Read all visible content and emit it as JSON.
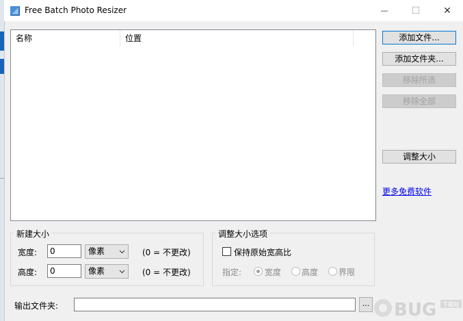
{
  "window": {
    "title": "Free Batch Photo Resizer",
    "minimize_glyph": "—",
    "maximize_glyph": "☐",
    "close_glyph": "✕"
  },
  "file_list": {
    "columns": [
      {
        "label": "名称"
      },
      {
        "label": "位置"
      }
    ]
  },
  "buttons": {
    "add_files": "添加文件...",
    "add_folder": "添加文件夹...",
    "remove_selected": "移除所选",
    "remove_all": "移除全部",
    "resize": "调整大小"
  },
  "more_software_link": "更多免费软件",
  "new_size": {
    "group_title": "新建大小",
    "width_label": "宽度:",
    "width_value": "0",
    "width_unit": "像素",
    "width_hint": "(0 = 不更改)",
    "height_label": "高度:",
    "height_value": "0",
    "height_unit": "像素",
    "height_hint": "(0 = 不更改)"
  },
  "resize_options": {
    "group_title": "调整大小选项",
    "keep_ratio_label": "保持原始宽高比",
    "keep_ratio_checked": false,
    "specify_label": "指定:",
    "radios": [
      {
        "label": "宽度",
        "checked": true
      },
      {
        "label": "高度",
        "checked": false
      },
      {
        "label": "界限",
        "checked": false
      }
    ]
  },
  "output": {
    "label": "输出文件夹:",
    "value": "",
    "browse_label": "..."
  },
  "watermark": {
    "text": "BUG",
    "subtext": "下载站"
  },
  "colors": {
    "primary_border": "#0078d7",
    "link": "#0000ee",
    "disabled_text": "#a0a0a0"
  }
}
